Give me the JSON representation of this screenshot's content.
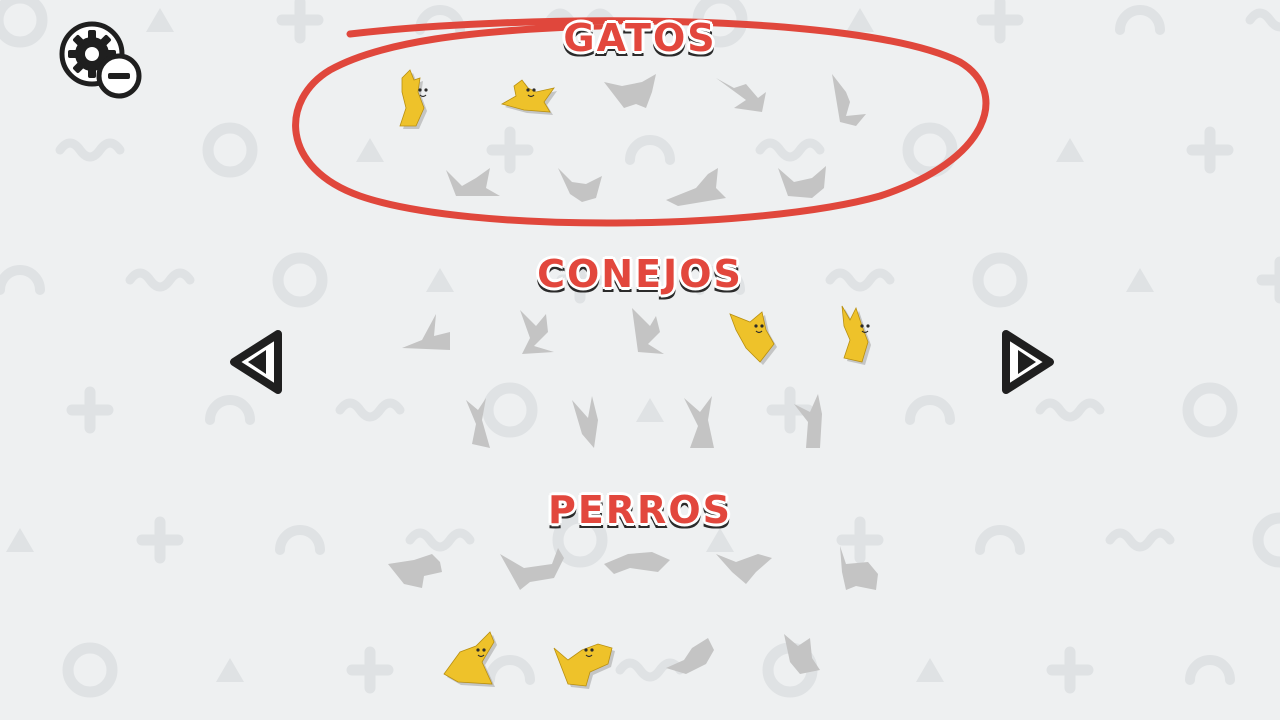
{
  "background_color": "#eef0f1",
  "title_color": "#e2473d",
  "solved_color": "#eec22a",
  "locked_color": "#c4c4c4",
  "highlight_color": "#e0473c",
  "categories": [
    {
      "id": "gatos",
      "title": "GATOS",
      "highlighted": true,
      "puzzles": [
        {
          "index": 1,
          "solved": true
        },
        {
          "index": 2,
          "solved": true
        },
        {
          "index": 3,
          "solved": false
        },
        {
          "index": 4,
          "solved": false
        },
        {
          "index": 5,
          "solved": false
        },
        {
          "index": 6,
          "solved": false
        },
        {
          "index": 7,
          "solved": false
        },
        {
          "index": 8,
          "solved": false
        },
        {
          "index": 9,
          "solved": false
        }
      ]
    },
    {
      "id": "conejos",
      "title": "CONEJOS",
      "highlighted": false,
      "puzzles": [
        {
          "index": 1,
          "solved": false
        },
        {
          "index": 2,
          "solved": false
        },
        {
          "index": 3,
          "solved": false
        },
        {
          "index": 4,
          "solved": true
        },
        {
          "index": 5,
          "solved": true
        },
        {
          "index": 6,
          "solved": false
        },
        {
          "index": 7,
          "solved": false
        },
        {
          "index": 8,
          "solved": false
        },
        {
          "index": 9,
          "solved": false
        }
      ]
    },
    {
      "id": "perros",
      "title": "PERROS",
      "highlighted": false,
      "puzzles": [
        {
          "index": 1,
          "solved": false
        },
        {
          "index": 2,
          "solved": false
        },
        {
          "index": 3,
          "solved": false
        },
        {
          "index": 4,
          "solved": false
        },
        {
          "index": 5,
          "solved": false
        },
        {
          "index": 6,
          "solved": true
        },
        {
          "index": 7,
          "solved": true
        },
        {
          "index": 8,
          "solved": false
        },
        {
          "index": 9,
          "solved": false
        }
      ]
    }
  ],
  "controls": {
    "settings_icon": "gear-minus-icon",
    "prev_icon": "triangle-left-icon",
    "next_icon": "triangle-right-icon"
  }
}
